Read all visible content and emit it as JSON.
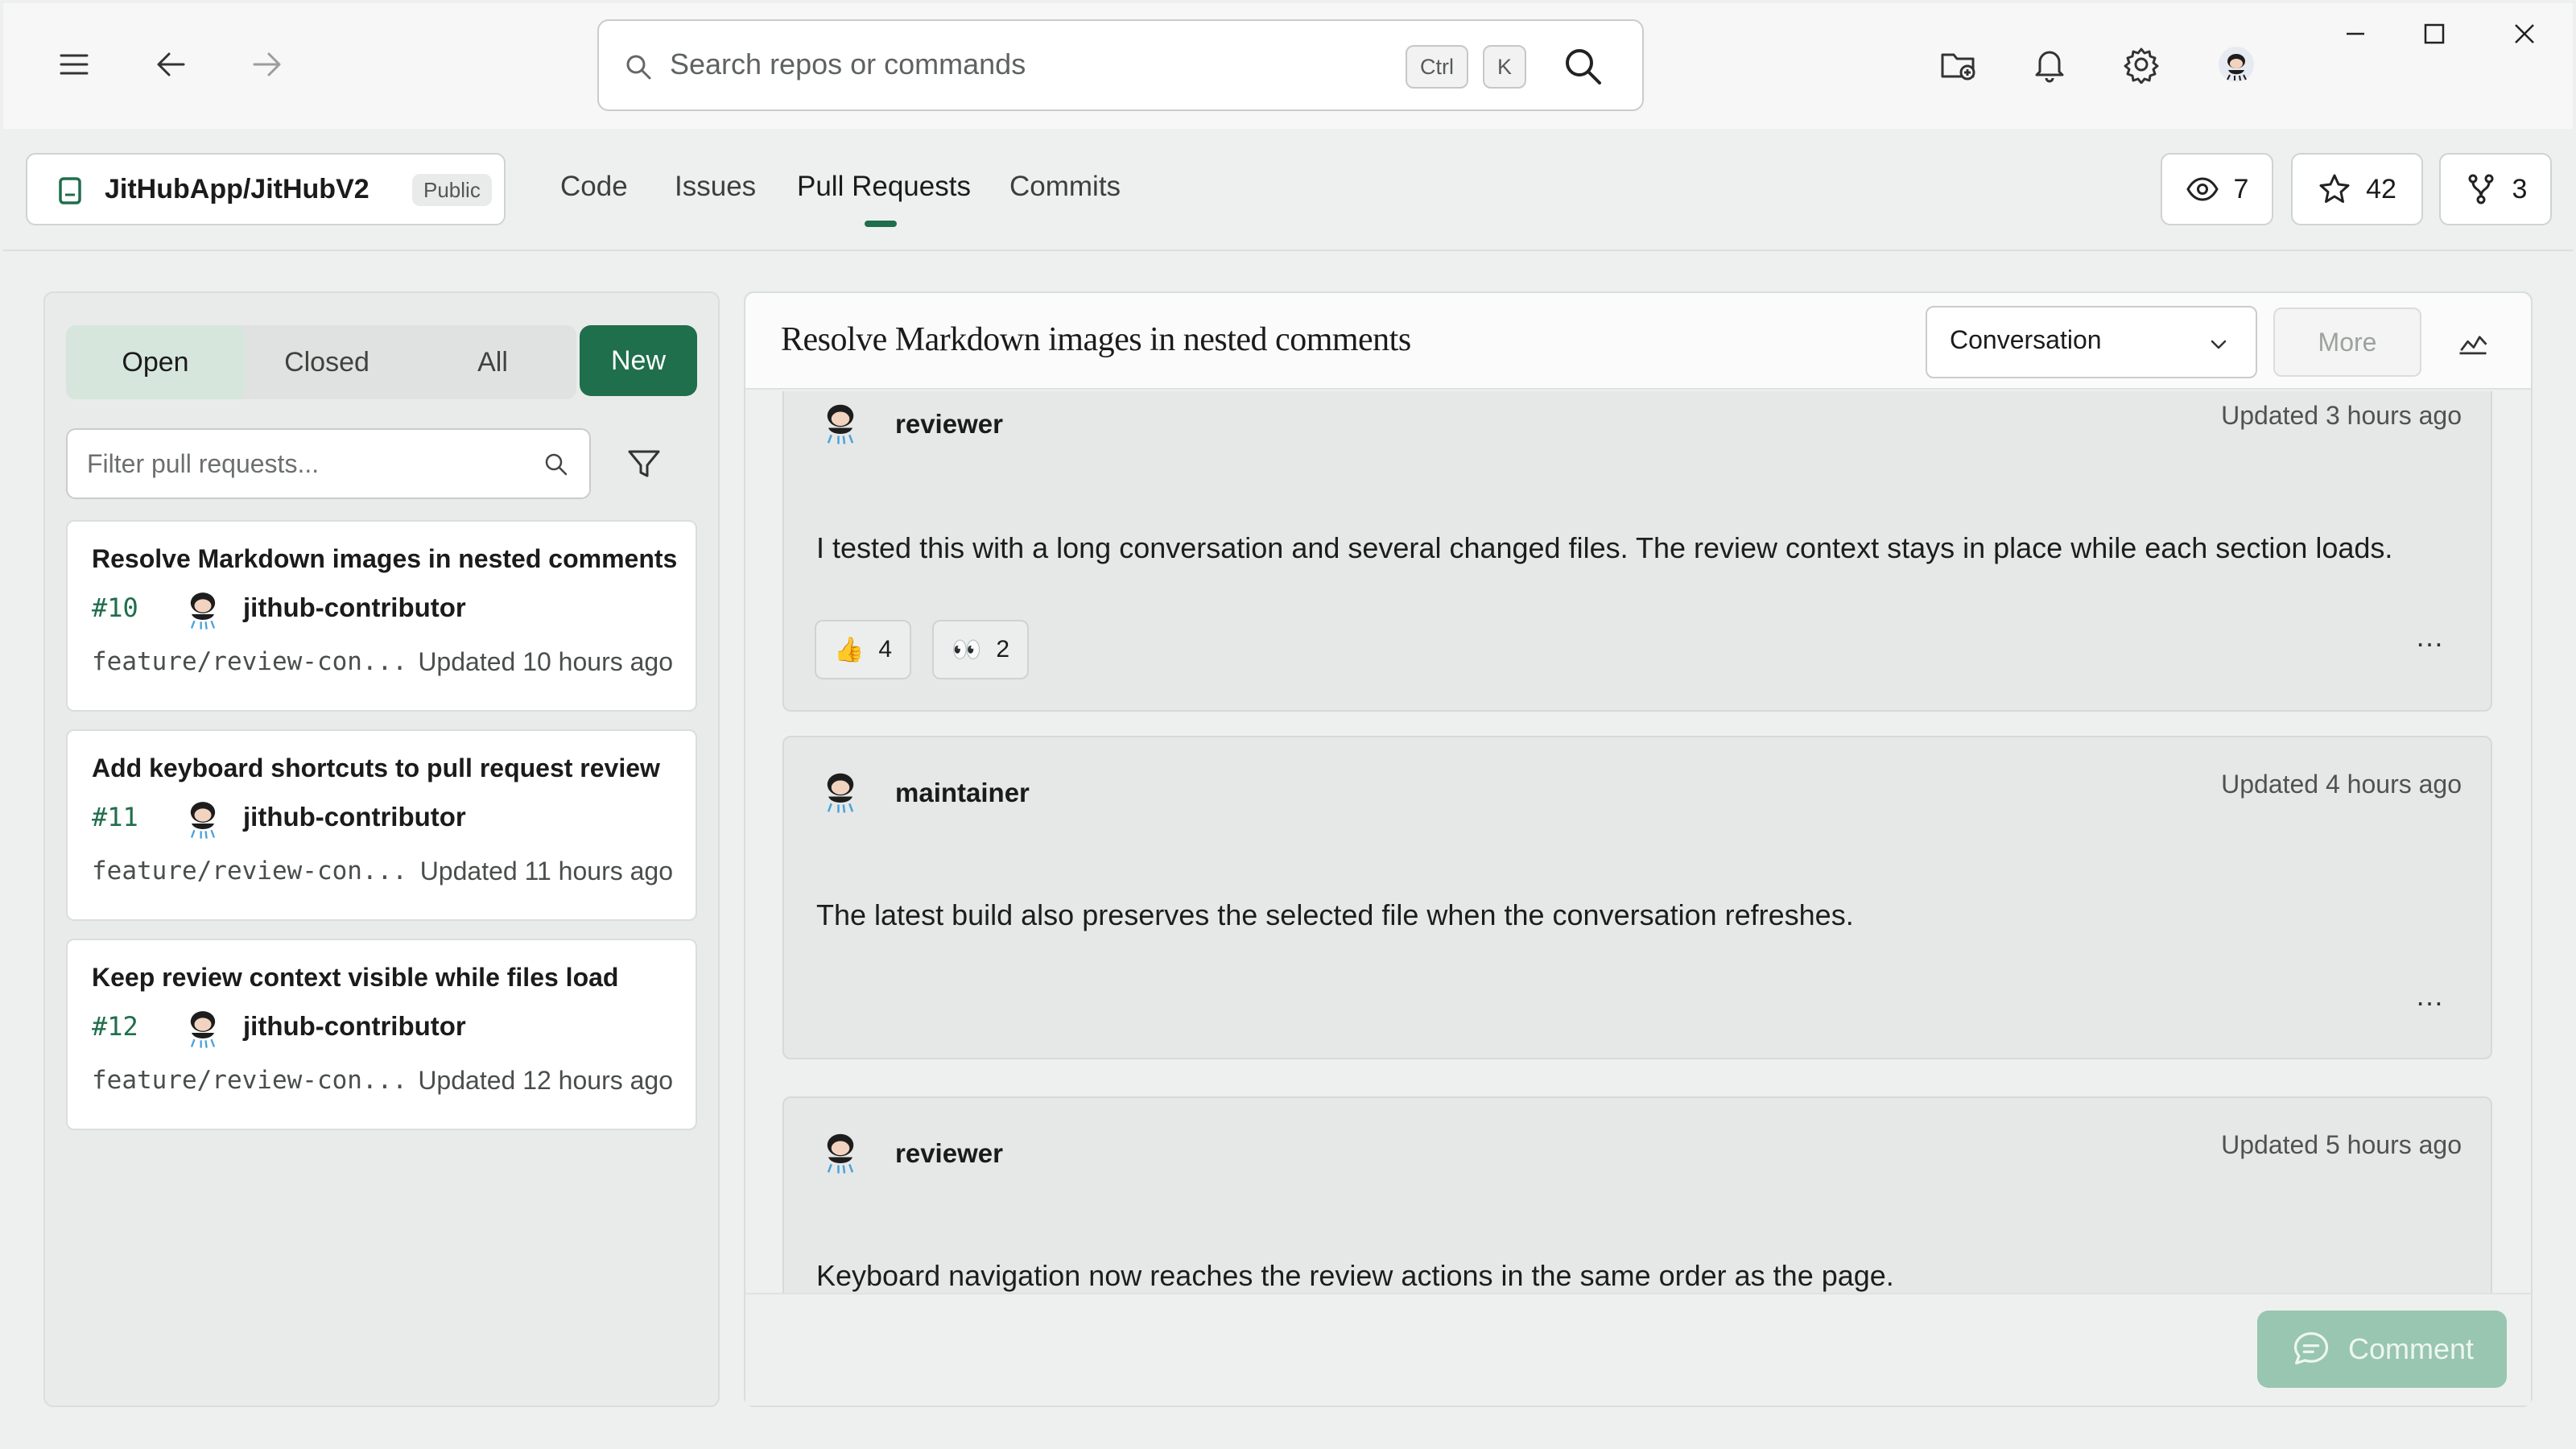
{
  "window": {
    "minimize": "minimize",
    "maximize": "maximize",
    "close": "close"
  },
  "search": {
    "placeholder": "Search repos or commands",
    "shortcut_ctrl": "Ctrl",
    "shortcut_key": "K"
  },
  "repo": {
    "name": "JitHubApp/JitHubV2",
    "visibility": "Public"
  },
  "tabs": [
    {
      "label": "Code"
    },
    {
      "label": "Issues"
    },
    {
      "label": "Pull Requests",
      "active": true
    },
    {
      "label": "Commits"
    }
  ],
  "stats": {
    "watchers": "7",
    "stars": "42",
    "forks": "3"
  },
  "pr_list": {
    "filters": {
      "open": "Open",
      "closed": "Closed",
      "all": "All",
      "active": "Open"
    },
    "new_label": "New",
    "filter_placeholder": "Filter pull requests...",
    "items": [
      {
        "title": "Resolve Markdown images in nested comments",
        "number": "#10",
        "author": "jithub-contributor",
        "branch": "feature/review-con...",
        "updated": "Updated 10 hours ago"
      },
      {
        "title": "Add keyboard shortcuts to pull request review",
        "number": "#11",
        "author": "jithub-contributor",
        "branch": "feature/review-con...",
        "updated": "Updated 11 hours ago"
      },
      {
        "title": "Keep review context visible while files load",
        "number": "#12",
        "author": "jithub-contributor",
        "branch": "feature/review-con...",
        "updated": "Updated 12 hours ago"
      }
    ]
  },
  "detail": {
    "title": "Resolve Markdown images in nested comments",
    "view": "Conversation",
    "more_label": "More",
    "comments": [
      {
        "author": "reviewer",
        "updated": "Updated 3 hours ago",
        "body": "I tested this with a long conversation and several changed files. The review context stays in place while each section loads.",
        "reactions": [
          {
            "emoji": "👍",
            "count": "4"
          },
          {
            "emoji": "👀",
            "count": "2"
          }
        ]
      },
      {
        "author": "maintainer",
        "updated": "Updated 4 hours ago",
        "body": "The latest build also preserves the selected file when the conversation refreshes.",
        "reactions": []
      },
      {
        "author": "reviewer",
        "updated": "Updated 5 hours ago",
        "body": "Keyboard navigation now reaches the review actions in the same order as the page.",
        "reactions": []
      }
    ],
    "comment_button": "Comment"
  },
  "colors": {
    "accent": "#1f6e4c",
    "accent_disabled": "#98c6b0",
    "background": "#eef0ef"
  }
}
